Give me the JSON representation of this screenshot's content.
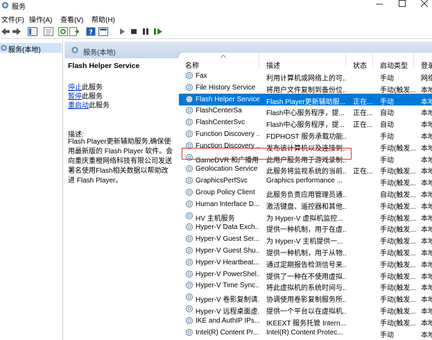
{
  "window": {
    "title": "服务"
  },
  "menus": [
    "文件(F)",
    "操作(A)",
    "查看(V)",
    "帮助(H)"
  ],
  "tree": {
    "node": "服务(本地)"
  },
  "header": {
    "title": "服务(本地)"
  },
  "details": {
    "service_name": "Flash Helper Service",
    "actions": [
      {
        "link": "停止",
        "suffix": "此服务"
      },
      {
        "link": "暂停",
        "suffix": "此服务"
      },
      {
        "link": "重启动",
        "suffix": "此服务"
      }
    ],
    "desc_label": "描述:",
    "desc_text": "Flash Player更新辅助服务,确保使用最新版的 Flash Player 软件。会向重庆重橙网络科技有限公司发送署名使用Flash相关数据以帮助改进 Flash Player。"
  },
  "columns": [
    "名称",
    "描述",
    "状态",
    "启动类型",
    "登录"
  ],
  "rows": [
    [
      "Fax",
      "利用计算机或网络上的可...",
      "",
      "手动",
      "网络"
    ],
    [
      "File History Service",
      "将用户文件复制到备份位...",
      "",
      "手动(触发...",
      "本地"
    ],
    [
      "Flash Helper Service",
      "Flash Player更新辅助服...",
      "正在...",
      "手动",
      "本地"
    ],
    [
      "FlashCenterSa",
      "Flash中心服务程序，提...",
      "正在...",
      "自动",
      "本地"
    ],
    [
      "FlashCenterSvc",
      "Flash中心服务程序，提...",
      "正在...",
      "自动",
      "本地"
    ],
    [
      "Function Discovery ...",
      "FDPHOST 服务承载功能...",
      "",
      "手动",
      "本地"
    ],
    [
      "Function Discovery ...",
      "发布该计算机以及连接到...",
      "",
      "手动(触发...",
      "本地"
    ],
    [
      "GameDVR 和广播用...",
      "此用户服务用于游戏录制...",
      "",
      "手动",
      "本地"
    ],
    [
      "Geolocation Service",
      "此服务将监视系统的当前...",
      "正在...",
      "手动(触发...",
      "本地"
    ],
    [
      "GraphicsPerfSvc",
      "Graphics performance ...",
      "",
      "手动(触发...",
      "本地"
    ],
    [
      "Group Policy Client",
      "此服务负责应用管理员通...",
      "",
      "自动(触发...",
      "本地"
    ],
    [
      "Human Interface D...",
      "激活键盘、遥控器和其他...",
      "",
      "手动(触发...",
      "本地"
    ],
    [
      "HV 主机服务",
      "为 Hyper-V 虚拟机监控...",
      "",
      "手动(触发...",
      "本地"
    ],
    [
      "Hyper-V Data Exch...",
      "提供一种机制，用于在虚...",
      "",
      "手动(触发...",
      "本地"
    ],
    [
      "Hyper-V Guest Ser...",
      "为 Hyper-V 主机提供一...",
      "",
      "手动(触发...",
      "本地"
    ],
    [
      "Hyper-V Guest Shu...",
      "提供一种机制，用于从物...",
      "",
      "手动(触发...",
      "本地"
    ],
    [
      "Hyper-V Heartbeat...",
      "通过定期报告检测信号来...",
      "",
      "手动(触发...",
      "本地"
    ],
    [
      "Hyper-V PowerShel...",
      "提供了一种在不使用虚拟...",
      "",
      "手动(触发...",
      "本地"
    ],
    [
      "Hyper-V Time Sync...",
      "将此虚拟机的系统时间与...",
      "",
      "手动(触发...",
      "本地"
    ],
    [
      "Hyper-V 卷影复制请...",
      "协调使用卷影复制服务所...",
      "",
      "手动(触发...",
      "本地"
    ],
    [
      "Hyper-V 远程桌面虚...",
      "提供一个平台以在虚拟机...",
      "",
      "手动(触发...",
      "本地"
    ],
    [
      "IKE and AuthIP IPs...",
      "IKEEXT 服务托管 Intern...",
      "",
      "手动(触发...",
      "本地"
    ],
    [
      "Intel(R) Content Pr...",
      "Intel(R) Content Protec...",
      "",
      "手动",
      "本地"
    ]
  ],
  "selected_row": 2,
  "colors": {
    "selection": "#0078d7",
    "highlight_box": "#e03030",
    "link": "#0033cc"
  }
}
